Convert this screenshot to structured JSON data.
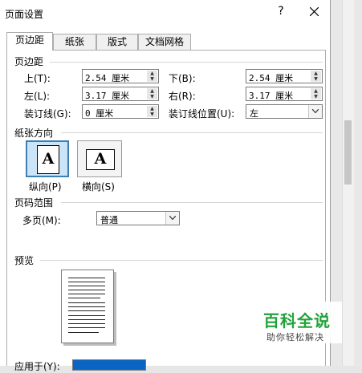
{
  "window": {
    "title": "页面设置",
    "help_label": "?"
  },
  "tabs": [
    {
      "label": "页边距",
      "active": true
    },
    {
      "label": "纸张",
      "active": false
    },
    {
      "label": "版式",
      "active": false
    },
    {
      "label": "文档网格",
      "active": false
    }
  ],
  "margins": {
    "section_title": "页边距",
    "top_label": "上(T):",
    "top_value": "2.54 厘米",
    "bottom_label": "下(B):",
    "bottom_value": "2.54 厘米",
    "left_label": "左(L):",
    "left_value": "3.17 厘米",
    "right_label": "右(R):",
    "right_value": "3.17 厘米",
    "gutter_label": "装订线(G):",
    "gutter_value": "0 厘米",
    "gutter_pos_label": "装订线位置(U):",
    "gutter_pos_value": "左"
  },
  "orientation": {
    "section_title": "纸张方向",
    "portrait_label": "纵向(P)",
    "landscape_label": "横向(S)",
    "icon_glyph": "A",
    "selected": "portrait"
  },
  "pages": {
    "section_title": "页码范围",
    "multiple_label": "多页(M):",
    "multiple_value": "普通"
  },
  "preview": {
    "section_title": "预览",
    "apply_label": "应用于(Y):"
  },
  "watermark": {
    "line1": "百科全说",
    "line2": "助你轻松解决"
  },
  "colors": {
    "accent": "#3c7fb1",
    "selected_fill": "#cce4f7",
    "watermark_green": "#21a33b"
  }
}
